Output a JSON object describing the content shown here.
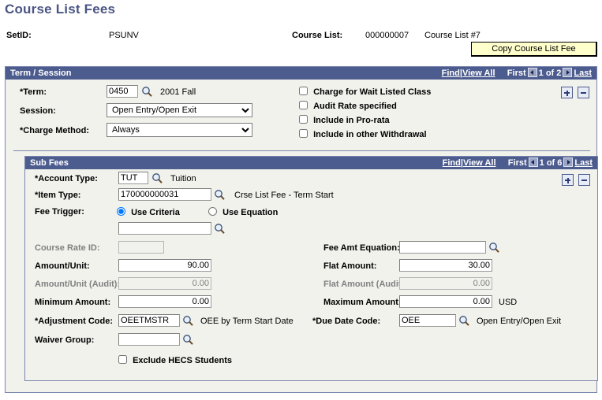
{
  "page": {
    "title": "Course List Fees"
  },
  "keys": {
    "setid_label": "SetID:",
    "setid_value": "PSUNV",
    "courselist_label": "Course List:",
    "courselist_value": "000000007",
    "courselist_desc": "Course List #7"
  },
  "actions": {
    "copy_course_list_fee": "Copy Course List Fee"
  },
  "term_session": {
    "header": "Term / Session",
    "nav": {
      "find": "Find",
      "separator": "|",
      "view_all": "View All",
      "first": "First",
      "counter": "1 of 2",
      "last": "Last",
      "prev_icon": "prev-arrow-icon",
      "next_icon": "next-arrow-icon"
    },
    "row_buttons": {
      "add": "add-row-button",
      "delete": "delete-row-button"
    },
    "fields": {
      "term_label": "*Term:",
      "term_value": "0450",
      "term_desc": "2001 Fall",
      "session_label": "Session:",
      "session_value": "Open Entry/Open Exit",
      "session_options": [
        "Open Entry/Open Exit"
      ],
      "charge_method_label": "*Charge Method:",
      "charge_method_value": "Always",
      "charge_method_options": [
        "Always"
      ]
    },
    "checkboxes": [
      {
        "label": "Charge for Wait Listed Class",
        "checked": false
      },
      {
        "label": "Audit Rate specified",
        "checked": false
      },
      {
        "label": "Include in Pro-rata",
        "checked": false
      },
      {
        "label": "Include in other Withdrawal",
        "checked": false
      }
    ]
  },
  "sub_fees": {
    "header": "Sub Fees",
    "nav": {
      "find": "Find",
      "separator": "|",
      "view_all": "View All",
      "first": "First",
      "counter": "1 of 6",
      "last": "Last",
      "prev_icon": "prev-arrow-icon",
      "next_icon": "next-arrow-icon"
    },
    "row_buttons": {
      "add": "add-row-button",
      "delete": "delete-row-button"
    },
    "fields": {
      "account_type_label": "*Account Type:",
      "account_type_value": "TUT",
      "account_type_desc": "Tuition",
      "item_type_label": "*Item Type:",
      "item_type_value": "170000000031",
      "item_type_desc": "Crse List Fee - Term Start",
      "fee_trigger_label": "Fee Trigger:",
      "fee_trigger_use_criteria": "Use Criteria",
      "fee_trigger_use_equation": "Use Equation",
      "fee_trigger_selected": "Use Criteria",
      "criteria_value": "",
      "course_rate_id_label": "Course Rate ID:",
      "course_rate_id_value": "",
      "fee_amt_equation_label": "Fee Amt Equation:",
      "fee_amt_equation_value": "",
      "amount_unit_label": "Amount/Unit:",
      "amount_unit_value": "90.00",
      "flat_amount_label": "Flat Amount:",
      "flat_amount_value": "30.00",
      "amount_unit_audit_label": "Amount/Unit (Audit):",
      "amount_unit_audit_value": "0.00",
      "flat_amount_audit_label": "Flat Amount (Audit):",
      "flat_amount_audit_value": "0.00",
      "minimum_amount_label": "Minimum Amount:",
      "minimum_amount_value": "0.00",
      "maximum_amount_label": "Maximum Amount:",
      "maximum_amount_value": "0.00",
      "currency": "USD",
      "adjustment_code_label": "*Adjustment Code:",
      "adjustment_code_value": "OEETMSTR",
      "adjustment_code_desc": "OEE by Term Start Date",
      "due_date_code_label": "*Due Date Code:",
      "due_date_code_value": "OEE",
      "due_date_code_desc": "Open Entry/Open Exit",
      "waiver_group_label": "Waiver Group:",
      "waiver_group_value": "",
      "exclude_hecs_label": "Exclude HECS Students",
      "exclude_hecs_checked": false
    }
  },
  "colors": {
    "header_bar": "#4d5c8f",
    "title": "#4a5584",
    "panel_bg": "#f1f2ec",
    "panel_border": "#7b86ad",
    "button_bg": "#ffffcc"
  }
}
